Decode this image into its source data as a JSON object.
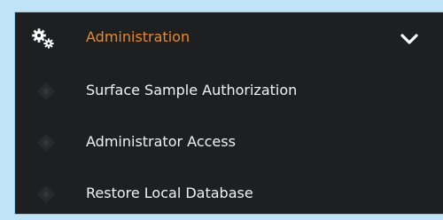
{
  "menu": {
    "header": {
      "label": "Administration",
      "icon": "gears-icon",
      "expand_icon": "chevron-down-icon",
      "label_color": "#e8892b"
    },
    "items": [
      {
        "label": "Surface Sample Authorization",
        "icon": "diamond-bullet-icon"
      },
      {
        "label": "Administrator Access",
        "icon": "diamond-bullet-icon"
      },
      {
        "label": "Restore Local Database",
        "icon": "diamond-bullet-icon"
      }
    ],
    "background": "#1e1f21",
    "item_text_color": "#f2f2f2"
  }
}
